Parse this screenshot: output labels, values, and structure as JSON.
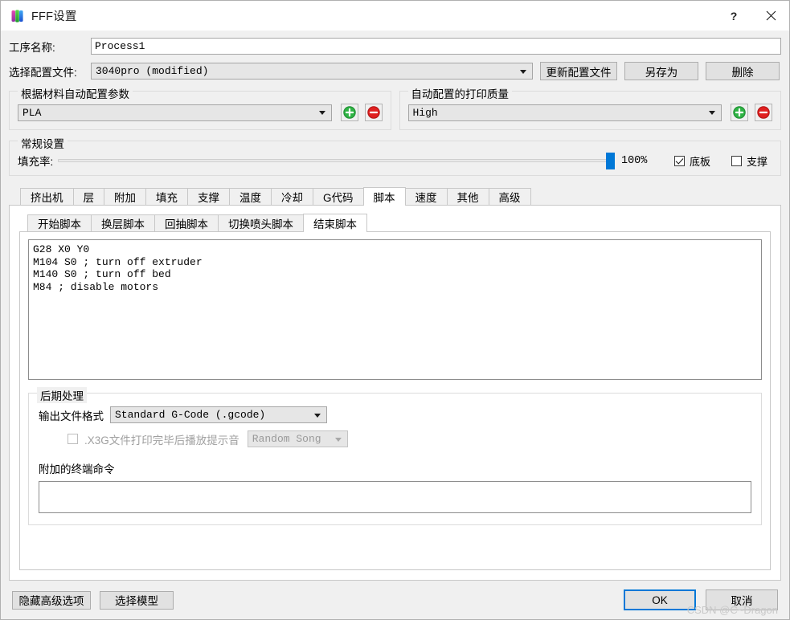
{
  "window": {
    "title": "FFF设置",
    "icon": "s3d-logo-icon",
    "help_label": "?",
    "close_label": "✕"
  },
  "form": {
    "process_name_label": "工序名称:",
    "process_name_value": "Process1",
    "profile_label": "选择配置文件:",
    "profile_value": "3040pro (modified)",
    "update_profile_label": "更新配置文件",
    "save_as_label": "另存为",
    "delete_label": "删除"
  },
  "material_group": {
    "title": "根据材料自动配置参数",
    "value": "PLA",
    "add_label": "+",
    "remove_label": "−"
  },
  "quality_group": {
    "title": "自动配置的打印质量",
    "value": "High",
    "add_label": "+",
    "remove_label": "−"
  },
  "general_group": {
    "title": "常规设置",
    "infill_label": "填充率:",
    "infill_percent": "100%",
    "infill_value": 100,
    "raft_label": "底板",
    "raft_checked": true,
    "support_label": "支撑",
    "support_checked": false
  },
  "tabs": [
    {
      "label": "挤出机",
      "active": false
    },
    {
      "label": "层",
      "active": false
    },
    {
      "label": "附加",
      "active": false
    },
    {
      "label": "填充",
      "active": false
    },
    {
      "label": "支撑",
      "active": false
    },
    {
      "label": "温度",
      "active": false
    },
    {
      "label": "冷却",
      "active": false
    },
    {
      "label": "G代码",
      "active": false
    },
    {
      "label": "脚本",
      "active": true
    },
    {
      "label": "速度",
      "active": false
    },
    {
      "label": "其他",
      "active": false
    },
    {
      "label": "高级",
      "active": false
    }
  ],
  "subtabs": [
    {
      "label": "开始脚本",
      "active": false
    },
    {
      "label": "换层脚本",
      "active": false
    },
    {
      "label": "回抽脚本",
      "active": false
    },
    {
      "label": "切换喷头脚本",
      "active": false
    },
    {
      "label": "结束脚本",
      "active": true
    }
  ],
  "script": {
    "code": "G28 X0 Y0\nM104 S0 ; turn off extruder\nM140 S0 ; turn off bed\nM84 ; disable motors"
  },
  "post_processing": {
    "title": "后期处理",
    "output_format_label": "输出文件格式",
    "output_format_value": "Standard G-Code (.gcode)",
    "x3g_sound_label": ".X3G文件打印完毕后播放提示音",
    "x3g_sound_checked": false,
    "song_value": "Random Song",
    "terminal_label": "附加的终端命令",
    "terminal_value": ""
  },
  "footer": {
    "hide_advanced_label": "隐藏高级选项",
    "select_model_label": "选择模型",
    "ok_label": "OK",
    "cancel_label": "取消",
    "watermark": "CSDN @C~Dragon"
  },
  "colors": {
    "accent": "#0078d7",
    "add_green": "#27ab38",
    "remove_red": "#e02020",
    "window_bg": "#f0f0f0"
  }
}
